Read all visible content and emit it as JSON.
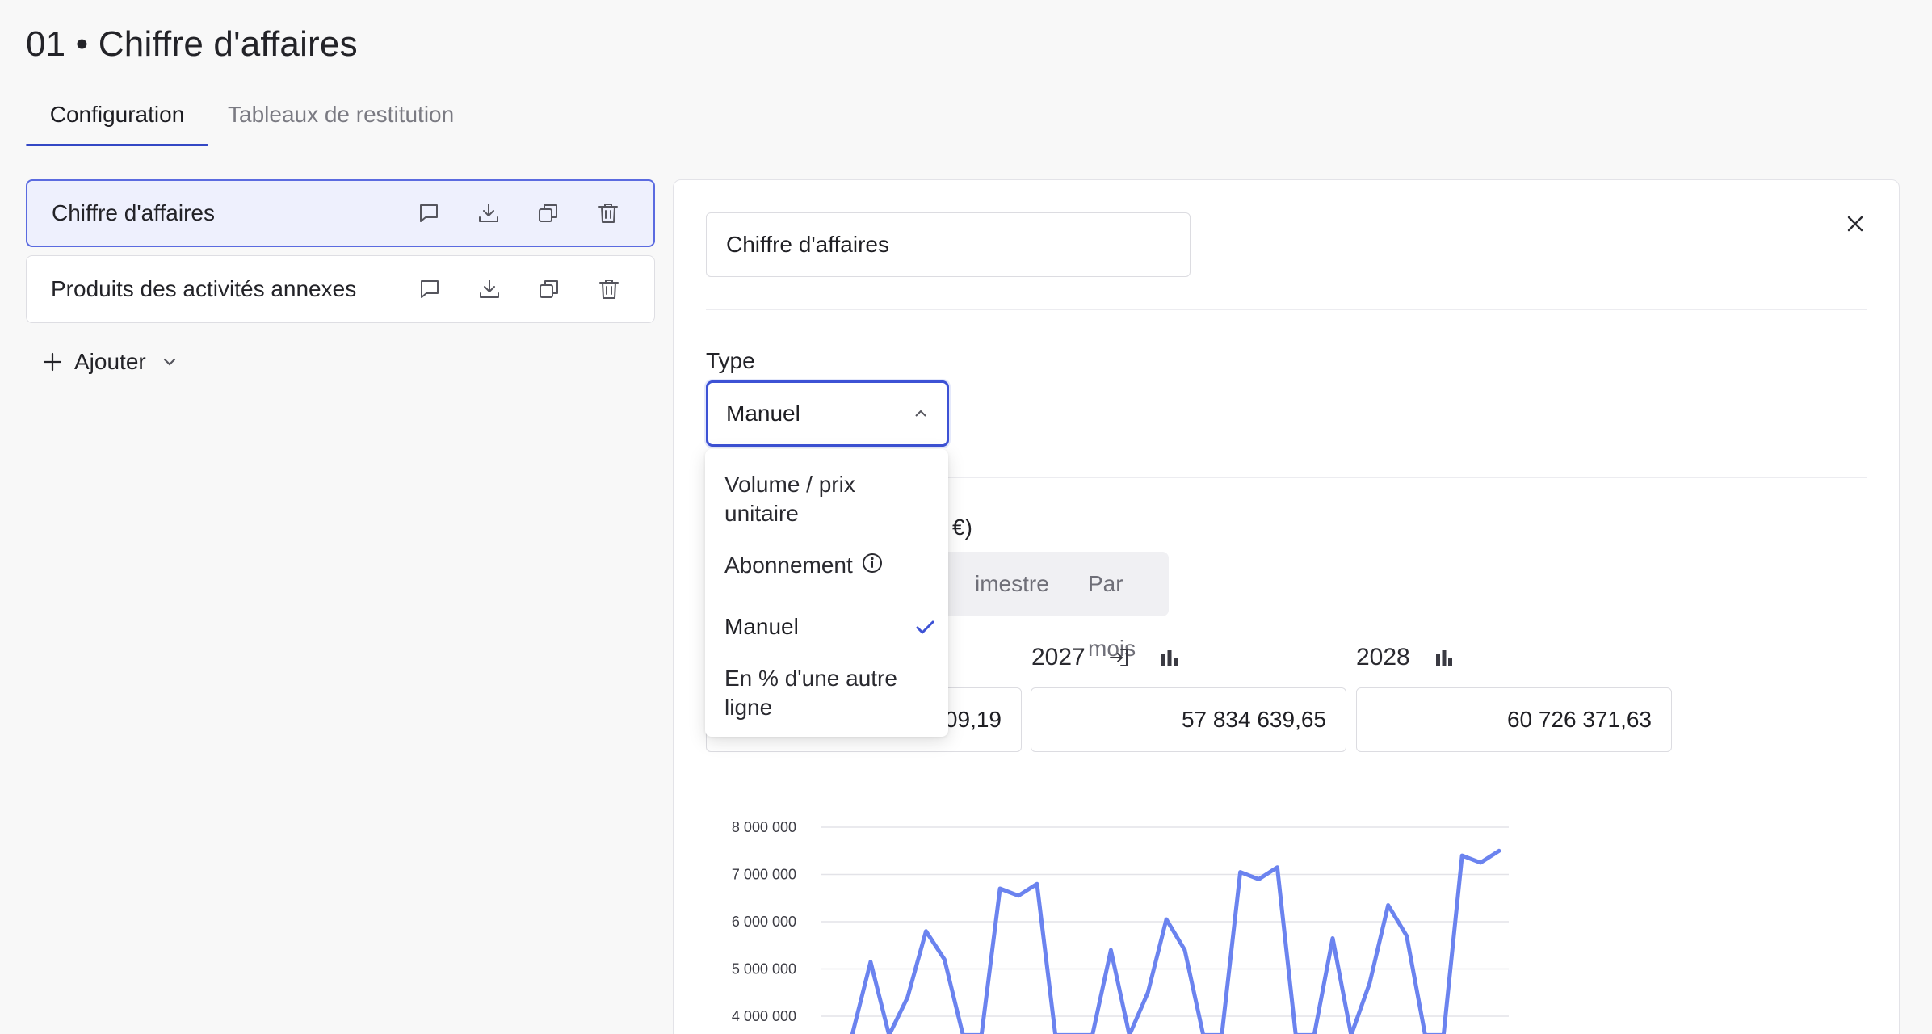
{
  "page": {
    "title": "01 • Chiffre d'affaires"
  },
  "tabs": [
    {
      "label": "Configuration",
      "active": true
    },
    {
      "label": "Tableaux de restitution",
      "active": false
    }
  ],
  "lines": [
    {
      "label": "Chiffre d'affaires",
      "active": true
    },
    {
      "label": "Produits des activités annexes",
      "active": false
    }
  ],
  "add": {
    "label": "Ajouter"
  },
  "editor": {
    "name_value": "Chiffre d'affaires",
    "type_label": "Type",
    "type_value": "Manuel",
    "heading_fragment": "€)",
    "period_tabs": [
      "imestre",
      "Par mois"
    ],
    "years": [
      {
        "label": "2027",
        "value": "57 834 639,65"
      },
      {
        "label": "2028",
        "value": "60 726 371,63"
      }
    ],
    "first_value_fragment": "09,19"
  },
  "dropdown": {
    "options": [
      {
        "label": "Volume / prix unitaire",
        "selected": false
      },
      {
        "label": "Abonnement",
        "selected": false,
        "info": true
      },
      {
        "label": "Manuel",
        "selected": true
      },
      {
        "label": "En % d'une autre ligne",
        "selected": false
      }
    ]
  },
  "colors": {
    "accent": "#3d52d5",
    "series": "#6b83ef",
    "active_bg": "#eef0fd"
  },
  "chart_data": {
    "type": "line",
    "y_ticks": [
      "8 000 000",
      "7 000 000",
      "6 000 000",
      "5 000 000",
      "4 000 000"
    ],
    "ylim": [
      3600000,
      8000000
    ],
    "grid": true,
    "series": [
      {
        "values": [
          3600000,
          5150000,
          3600000,
          4400000,
          5800000,
          5200000,
          3600000,
          3600000,
          6700000,
          6550000,
          6800000,
          3600000,
          3600000,
          3600000,
          5400000,
          3600000,
          4500000,
          6050000,
          5400000,
          3600000,
          3600000,
          7050000,
          6900000,
          7150000,
          3600000,
          3600000,
          5650000,
          3600000,
          4700000,
          6350000,
          5700000,
          3600000,
          3600000,
          7400000,
          7250000,
          7500000
        ]
      }
    ]
  }
}
